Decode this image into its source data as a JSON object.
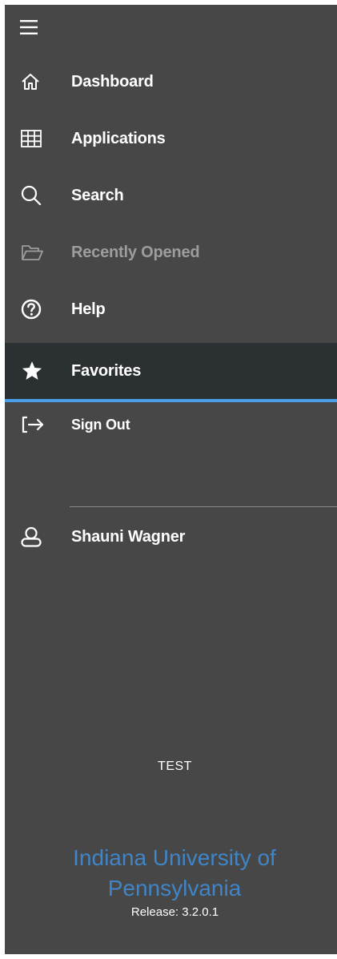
{
  "navigation": {
    "items": [
      {
        "id": "dashboard",
        "label": "Dashboard",
        "icon": "home-icon"
      },
      {
        "id": "applications",
        "label": "Applications",
        "icon": "grid-icon"
      },
      {
        "id": "search",
        "label": "Search",
        "icon": "search-icon"
      },
      {
        "id": "recently-opened",
        "label": "Recently Opened",
        "icon": "folder-open-icon",
        "state": "disabled"
      },
      {
        "id": "help",
        "label": "Help",
        "icon": "help-icon"
      },
      {
        "id": "favorites",
        "label": "Favorites",
        "icon": "star-icon",
        "state": "selected"
      },
      {
        "id": "sign-out",
        "label": "Sign Out",
        "icon": "sign-out-icon"
      }
    ]
  },
  "user": {
    "name": "Shauni Wagner",
    "icon": "user-icon"
  },
  "footer": {
    "environment": "TEST",
    "institution": "Indiana University of Pennsylvania",
    "release": "Release: 3.2.0.1"
  },
  "colors": {
    "panel_background": "#474747",
    "selected_background": "#2b3033",
    "selected_underline": "#4a9ee6",
    "institution_text": "#3f85c7",
    "disabled_text": "#9d9d9d"
  }
}
